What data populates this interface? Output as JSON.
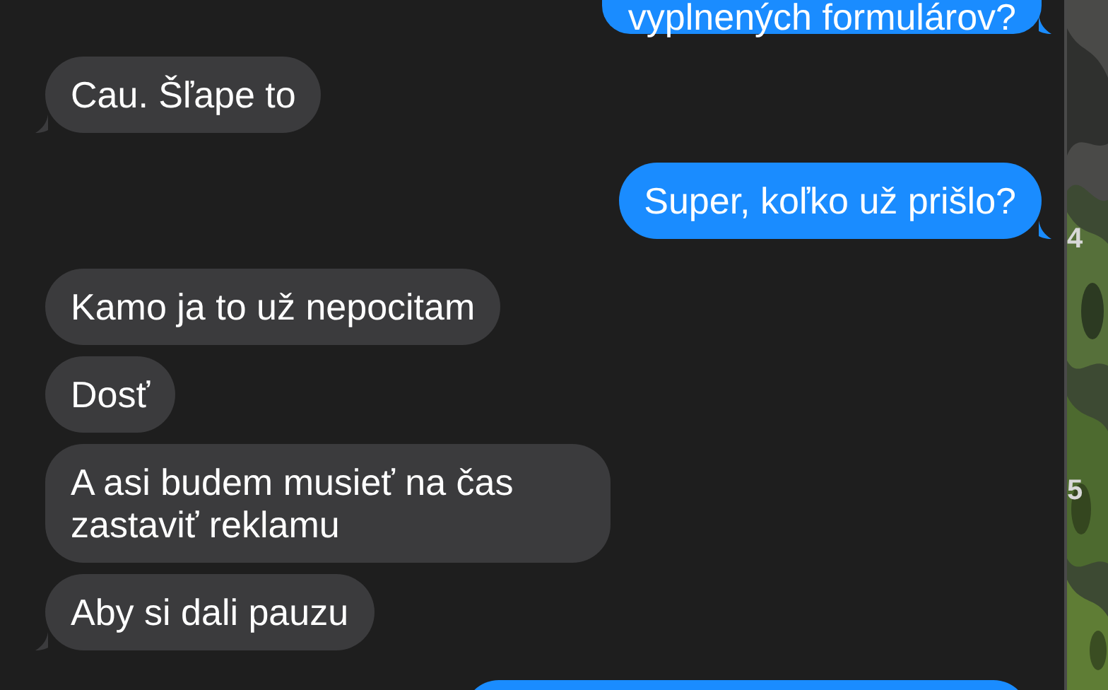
{
  "messages": [
    {
      "kind": "outgoing",
      "text": "vyplnených formulárov?",
      "tail": true
    },
    {
      "kind": "incoming",
      "text": "Cau. Šľape to",
      "tail": true
    },
    {
      "kind": "outgoing",
      "text": "Super, koľko už prišlo?",
      "tail": true
    },
    {
      "kind": "incoming",
      "text": "Kamo ja to už nepocitam",
      "tail": false
    },
    {
      "kind": "incoming",
      "text": "Dosť",
      "tail": false
    },
    {
      "kind": "incoming",
      "text": "A asi budem musieť na čas zastaviť reklamu",
      "tail": false
    },
    {
      "kind": "incoming",
      "text": "Aby si dali pauzu",
      "tail": true
    },
    {
      "kind": "outgoing"
    }
  ],
  "background_window": {
    "labels": [
      "4",
      "5"
    ]
  }
}
